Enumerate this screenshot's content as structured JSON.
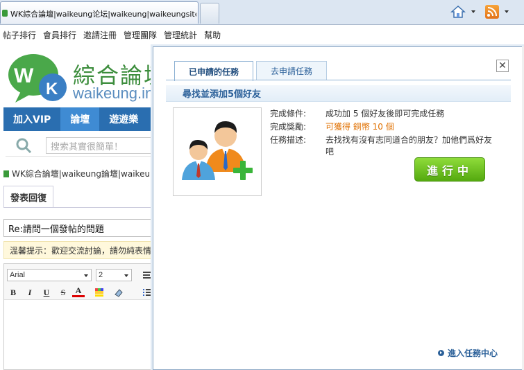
{
  "browser": {
    "tab_title": "WK綜合論壇|waikeung论坛|waikeung|waikeungsitebb..."
  },
  "site": {
    "top_menu": [
      "帖子排行",
      "會員排行",
      "邀請注冊",
      "管理團隊",
      "管理統計",
      "幫助"
    ],
    "logo": {
      "cn": "綜合論壇",
      "en": "waikeung.info"
    },
    "nav": [
      "加入VIP",
      "論壇",
      "遊遊樂"
    ],
    "search_placeholder": "搜索其實很簡單！",
    "breadcrumb": "WK綜合論壇|waikeung論壇|waikeung",
    "reply_tab": "發表回復",
    "subject": "Re:請問一個發帖的問題",
    "notice": "溫馨提示：歡迎交流討論，請勿純表情",
    "editor": {
      "font": "Arial",
      "size": "2"
    }
  },
  "dialog": {
    "tabs": [
      "已申請的任務",
      "去申請任務"
    ],
    "active_tab": "已申請的任務",
    "task_title": "尋找並添加5個好友",
    "fields": [
      {
        "label": "完成條件:",
        "value": "成功加 5 個好友後即可完成任務"
      },
      {
        "label": "完成獎勵:",
        "value": "可獲得 銅幣 10 個"
      },
      {
        "label": "任務描述:",
        "value": "去找找有沒有志同道合的朋友？加他們爲好友吧"
      }
    ],
    "status_button": "進行中",
    "task_center_link": "進入任務中心"
  }
}
